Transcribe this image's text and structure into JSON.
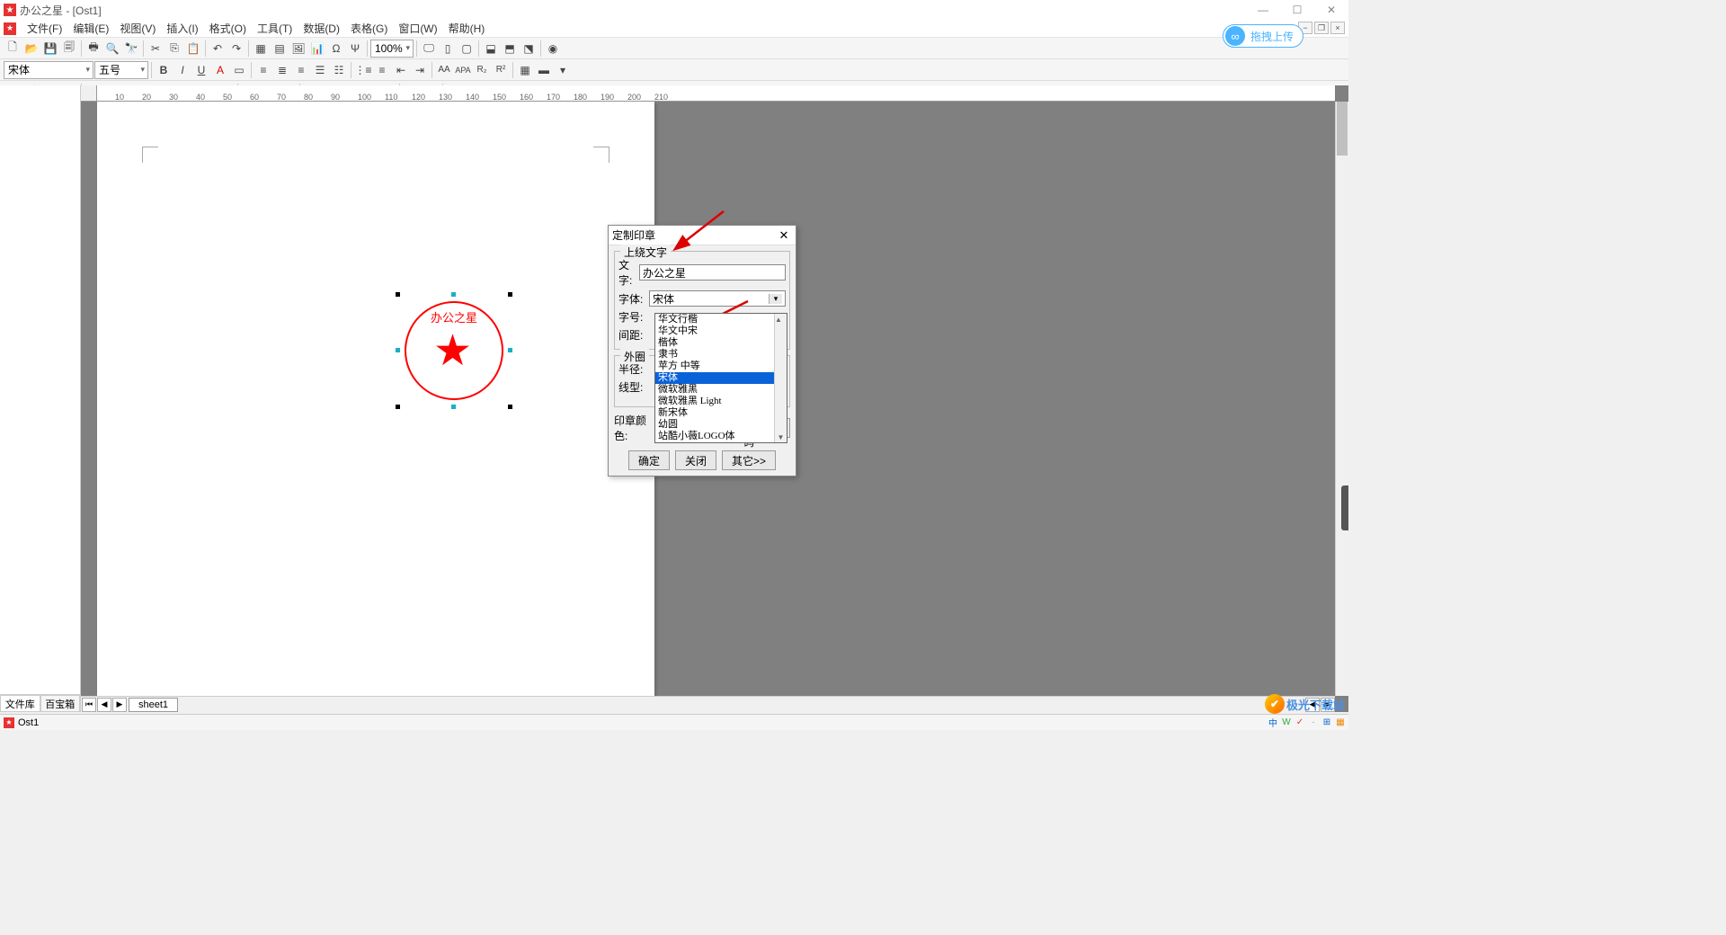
{
  "app": {
    "title": "办公之星 - [Ost1]",
    "upload_badge": "拖拽上传"
  },
  "menu": [
    "文件(F)",
    "编辑(E)",
    "视图(V)",
    "插入(I)",
    "格式(O)",
    "工具(T)",
    "数据(D)",
    "表格(G)",
    "窗口(W)",
    "帮助(H)"
  ],
  "toolbar": {
    "font_name": "宋体",
    "font_size": "五号",
    "zoom": "100%"
  },
  "left_tabs": [
    "文件库",
    "百宝箱"
  ],
  "sheet": {
    "tab": "sheet1"
  },
  "stamp": {
    "text": "办公之星"
  },
  "ruler": [
    "10",
    "20",
    "30",
    "40",
    "50",
    "60",
    "70",
    "80",
    "90",
    "100",
    "110",
    "120",
    "130",
    "140",
    "150",
    "160",
    "170",
    "180",
    "190",
    "200",
    "210"
  ],
  "dialog": {
    "title": "定制印章",
    "group1_legend": "上绕文字",
    "labels": {
      "text": "文字:",
      "font": "字体:",
      "fontsize": "字号:",
      "spacing": "间距:"
    },
    "text_value": "办公之星",
    "font_value": "宋体",
    "font_options": [
      "华文行楷",
      "华文中宋",
      "楷体",
      "隶书",
      "苹方 中等",
      "宋体",
      "微软雅黑",
      "微软雅黑 Light",
      "新宋体",
      "幼圆",
      "站酷小薇LOGO体"
    ],
    "font_selected_index": 5,
    "percent_suffix": "%",
    "group2_legend": "外圈",
    "labels2": {
      "radius": "半径:",
      "line": "线型:"
    },
    "color_label": "印章颜色:",
    "set_password": "设置印章密码",
    "btn_ok": "确定",
    "btn_close": "关闭",
    "btn_other": "其它>>"
  },
  "status": {
    "doc": "Ost1"
  },
  "watermark": "极光下载站"
}
